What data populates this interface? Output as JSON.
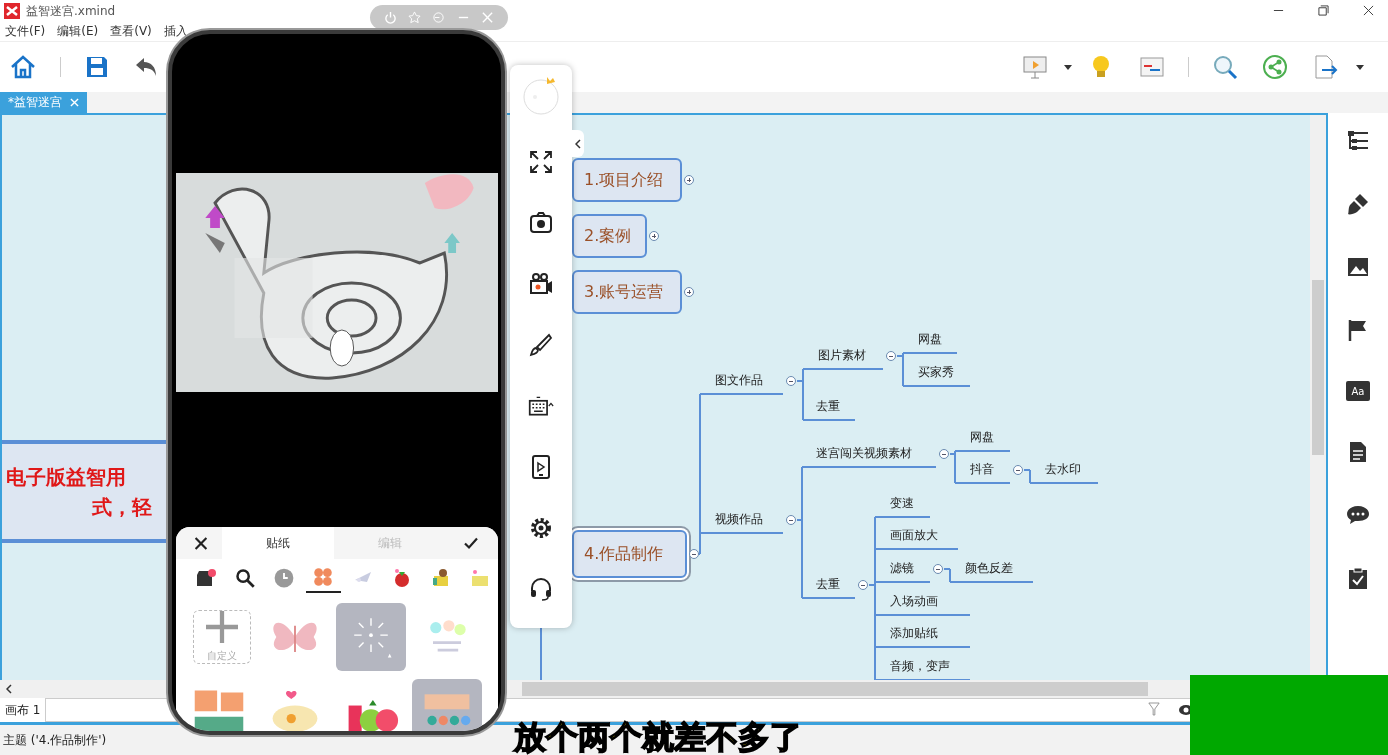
{
  "window": {
    "title": "益智迷宫.xmind"
  },
  "menu": [
    "文件(F)",
    "编辑(E)",
    "查看(V)",
    "插入"
  ],
  "tabs": [
    {
      "label": "*益智迷宫",
      "selected": true
    }
  ],
  "mind_map": {
    "left_topic_lines": [
      "电子版益智用",
      "式，轻"
    ],
    "topics": [
      {
        "label": "1.项目介绍",
        "selected": false,
        "expanded": false
      },
      {
        "label": "2.案例",
        "selected": false,
        "expanded": false
      },
      {
        "label": "3.账号运营",
        "selected": false,
        "expanded": false
      },
      {
        "label": "4.作品制作",
        "selected": true,
        "expanded": true,
        "children": [
          {
            "label": "图文作品",
            "expanded": true,
            "children": [
              {
                "label": "图片素材",
                "expanded": true,
                "children": [
                  {
                    "label": "网盘"
                  },
                  {
                    "label": "买家秀"
                  }
                ]
              },
              {
                "label": "去重"
              }
            ]
          },
          {
            "label": "视频作品",
            "expanded": true,
            "children": [
              {
                "label": "迷宫闯关视频素材",
                "expanded": true,
                "children": [
                  {
                    "label": "网盘"
                  },
                  {
                    "label": "抖音",
                    "expanded": true,
                    "children": [
                      {
                        "label": "去水印"
                      }
                    ]
                  }
                ]
              },
              {
                "label": "去重",
                "expanded": true,
                "children": [
                  {
                    "label": "变速"
                  },
                  {
                    "label": "画面放大"
                  },
                  {
                    "label": "滤镜",
                    "expanded": true,
                    "children": [
                      {
                        "label": "颜色反差"
                      }
                    ]
                  },
                  {
                    "label": "入场动画"
                  },
                  {
                    "label": "添加贴纸"
                  },
                  {
                    "label": "音频，变声"
                  }
                ]
              }
            ]
          }
        ]
      }
    ]
  },
  "sidebar_format_label": "Aa",
  "phone": {
    "panel_tabs": [
      {
        "label": "贴纸",
        "selected": true
      },
      {
        "label": "编辑",
        "selected": false
      }
    ],
    "sticker_categories": [
      {
        "kind": "store",
        "selected": false
      },
      {
        "kind": "search",
        "selected": false
      },
      {
        "kind": "recent",
        "selected": false
      },
      {
        "kind": "favorites",
        "selected": true
      },
      {
        "kind": "picture",
        "selected": false
      },
      {
        "kind": "picture",
        "selected": false
      },
      {
        "kind": "picture",
        "selected": false
      },
      {
        "kind": "picture",
        "selected": false
      }
    ],
    "stickers": [
      {
        "kind": "custom",
        "label": "自定义",
        "selected": false
      },
      {
        "kind": "picture",
        "selected": false
      },
      {
        "kind": "picture",
        "selected": true
      },
      {
        "kind": "picture",
        "selected": false
      },
      {
        "kind": "picture",
        "selected": false
      },
      {
        "kind": "picture",
        "selected": false
      },
      {
        "kind": "picture",
        "selected": false
      },
      {
        "kind": "picture",
        "selected": true
      }
    ]
  },
  "sheet_tabs": [
    {
      "label": "画布 1",
      "selected": true
    }
  ],
  "status_bar": "主题 ('4.作品制作')",
  "subtitle": "放个两个就差不多了"
}
